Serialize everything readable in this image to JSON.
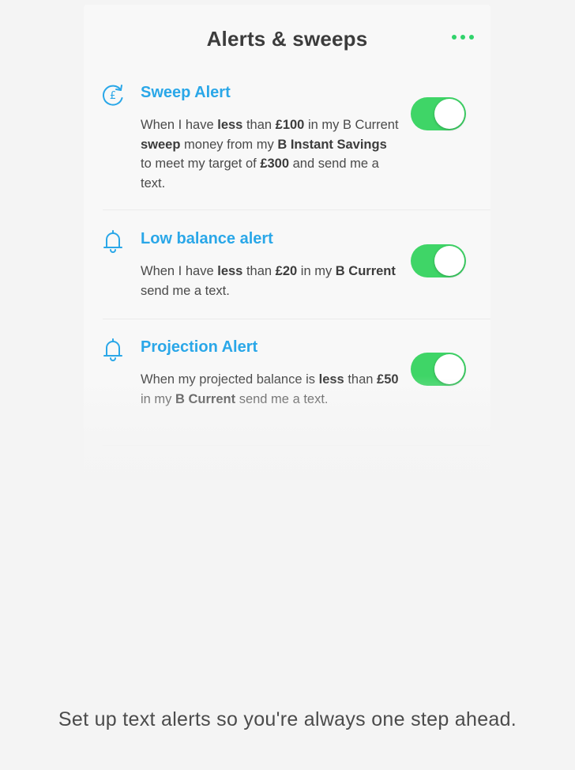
{
  "header": {
    "title": "Alerts & sweeps",
    "more_icon": "more-dots-icon"
  },
  "colors": {
    "accent_blue": "#2aa7e8",
    "toggle_green": "#3fd567",
    "menu_green": "#31d36b"
  },
  "alerts": [
    {
      "title": "Sweep Alert",
      "icon": "pound-sync-icon",
      "enabled": true,
      "desc": [
        {
          "t": "When I have ",
          "b": false
        },
        {
          "t": "less",
          "b": true
        },
        {
          "t": " than ",
          "b": false
        },
        {
          "t": "£100",
          "b": true
        },
        {
          "t": " in my B Current ",
          "b": false
        },
        {
          "t": "sweep",
          "b": true
        },
        {
          "t": " money from my ",
          "b": false
        },
        {
          "t": "B Instant Savings",
          "b": true
        },
        {
          "t": " to meet my target of ",
          "b": false
        },
        {
          "t": "£300",
          "b": true
        },
        {
          "t": " and send me a text.",
          "b": false
        }
      ]
    },
    {
      "title": "Low balance alert",
      "icon": "bell-icon",
      "enabled": true,
      "desc": [
        {
          "t": "When I have ",
          "b": false
        },
        {
          "t": "less",
          "b": true
        },
        {
          "t": " than ",
          "b": false
        },
        {
          "t": "£20",
          "b": true
        },
        {
          "t": " in my ",
          "b": false
        },
        {
          "t": "B Current",
          "b": true
        },
        {
          "t": " send me a text.",
          "b": false
        }
      ]
    },
    {
      "title": "Projection Alert",
      "icon": "bell-icon",
      "enabled": true,
      "desc": [
        {
          "t": "When my projected balance is ",
          "b": false
        },
        {
          "t": "less",
          "b": true
        },
        {
          "t": " than ",
          "b": false
        },
        {
          "t": "£50",
          "b": true
        },
        {
          "t": " in my ",
          "b": false
        },
        {
          "t": "B Current",
          "b": true
        },
        {
          "t": " send me a text.",
          "b": false
        }
      ]
    }
  ],
  "caption": "Set up text alerts so you're always one step ahead."
}
